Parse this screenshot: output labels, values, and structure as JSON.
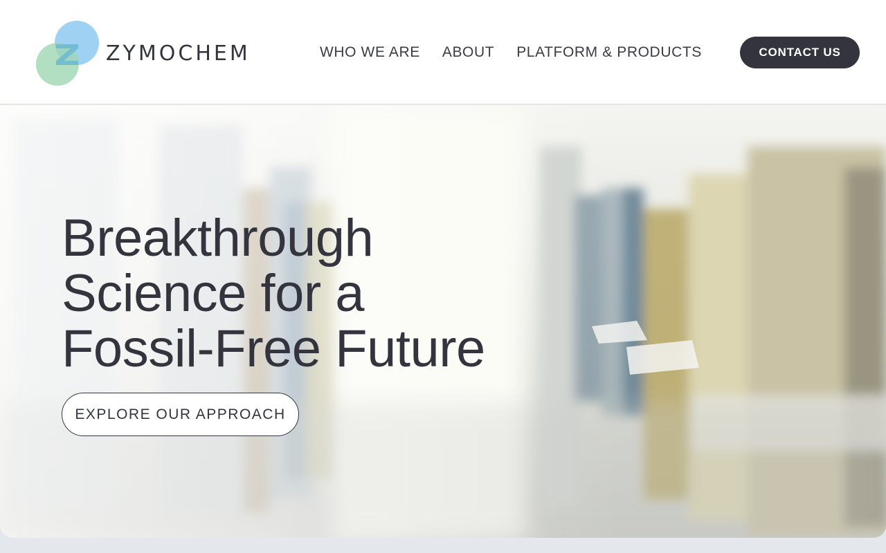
{
  "header": {
    "logo_text": "ZYMOCHEM",
    "nav": [
      {
        "label": "WHO WE ARE"
      },
      {
        "label": "ABOUT"
      },
      {
        "label": "PLATFORM & PRODUCTS"
      }
    ],
    "contact_label": "CONTACT US"
  },
  "hero": {
    "headline_lines": [
      "Breakthrough",
      "Science for a",
      "Fossil-Free Future"
    ],
    "cta_label": "EXPLORE OUR APPROACH"
  },
  "colors": {
    "text_dark": "#33343d",
    "logo_blue": "#8ec9f0",
    "logo_green": "#9fd6b3",
    "page_bg": "#e4e7ec"
  },
  "icons": {
    "logo_mark": "overlapping-circles-z-icon"
  }
}
